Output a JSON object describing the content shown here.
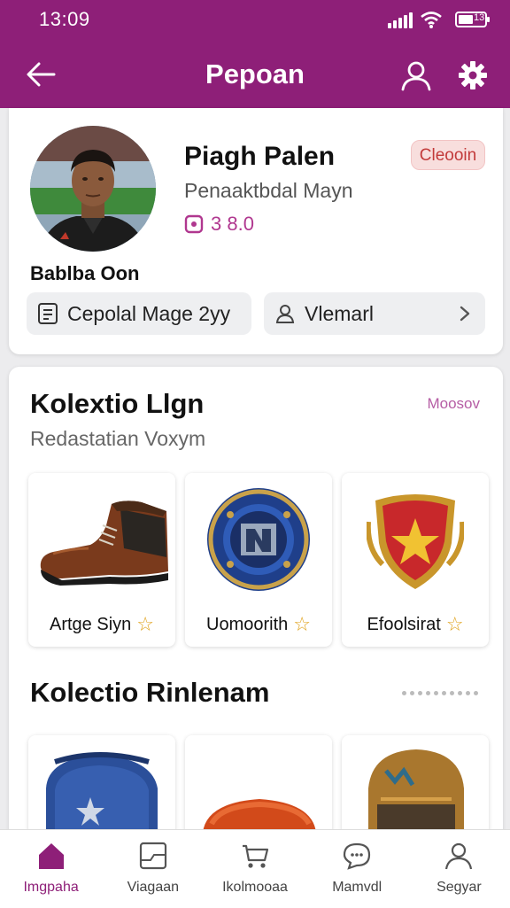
{
  "status_bar": {
    "time": "13:09",
    "battery": "13"
  },
  "header": {
    "title": "Pepoan"
  },
  "profile": {
    "name": "Piagh Palen",
    "team": "Penaaktbdal Mayn",
    "score": "3 8.0",
    "badge": "Cleooin",
    "handle": "Bablba Oon",
    "actions": [
      {
        "label": "Cepolal Mage 2yy",
        "icon": "document-icon"
      },
      {
        "label": "Vlemarl",
        "icon": "person-icon"
      }
    ]
  },
  "collections": {
    "section1": {
      "title": "Kolextio Llgn",
      "subtitle": "Redastatian Voxym",
      "more": "Moosov",
      "items": [
        {
          "label": "Artge Siyn",
          "icon": "boot-icon"
        },
        {
          "label": "Uomoorith",
          "icon": "medal-icon"
        },
        {
          "label": "Efoolsirat",
          "icon": "shield-icon"
        }
      ]
    },
    "section2": {
      "title": "Kolectio Rinlenam",
      "items": [
        {
          "icon": "backpack-icon"
        },
        {
          "icon": "cap-icon"
        },
        {
          "icon": "helmet-icon"
        }
      ]
    }
  },
  "bottom_nav": [
    {
      "label": "Imgpaha",
      "icon": "home-icon",
      "active": true
    },
    {
      "label": "Viagaan",
      "icon": "card-icon",
      "active": false
    },
    {
      "label": "Ikolmooaa",
      "icon": "cart-icon",
      "active": false
    },
    {
      "label": "Mamvdl",
      "icon": "chat-icon",
      "active": false
    },
    {
      "label": "Segyar",
      "icon": "person-icon",
      "active": false
    }
  ],
  "colors": {
    "accent": "#8e1f78",
    "badge_bg": "#f8dedd",
    "badge_text": "#c23a3a",
    "star": "#e0a21a"
  }
}
